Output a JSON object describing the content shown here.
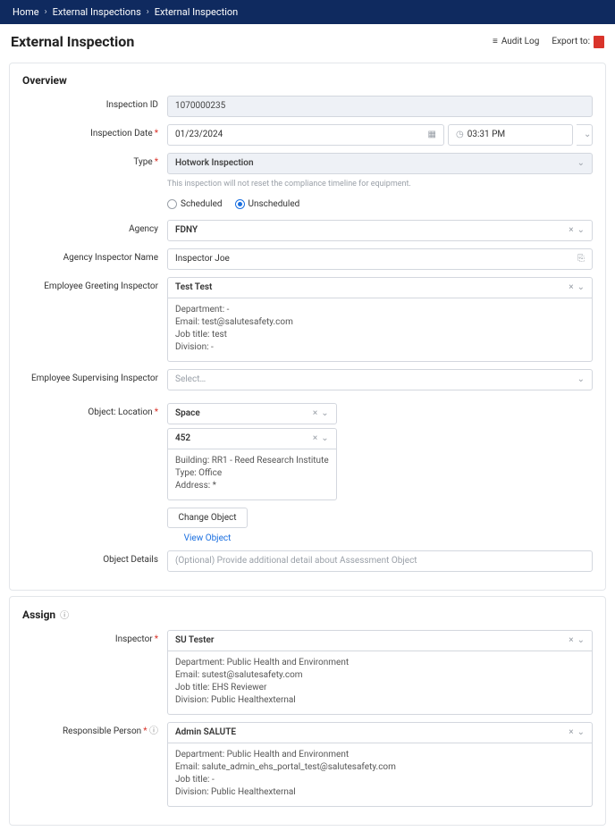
{
  "breadcrumbs": {
    "home": "Home",
    "list": "External Inspections",
    "current": "External Inspection"
  },
  "page": {
    "title": "External Inspection"
  },
  "header": {
    "audit_log": "Audit Log",
    "export_to": "Export to:"
  },
  "overview": {
    "heading": "Overview",
    "labels": {
      "inspection_id": "Inspection ID",
      "inspection_date": "Inspection Date",
      "type": "Type",
      "agency": "Agency",
      "agency_inspector_name": "Agency Inspector Name",
      "employee_greeting": "Employee Greeting Inspector",
      "employee_supervising": "Employee Supervising Inspector",
      "object_location": "Object: Location",
      "object_details": "Object Details"
    },
    "inspection_id": "1070000235",
    "inspection_date": "01/23/2024",
    "inspection_time": "03:31 PM",
    "type_value": "Hotwork Inspection",
    "type_helper": "This inspection will not reset the compliance timeline for equipment.",
    "schedule": {
      "scheduled_label": "Scheduled",
      "unscheduled_label": "Unscheduled",
      "value": "unscheduled"
    },
    "agency": "FDNY",
    "agency_inspector_name": "Inspector Joe",
    "employee_greeting": {
      "value": "Test Test",
      "department_label": "Department:",
      "department_value": "-",
      "email_label": "Email:",
      "email_value": "test@salutesafety.com",
      "job_title_label": "Job title:",
      "job_title_value": "test",
      "division_label": "Division:",
      "division_value": "-"
    },
    "employee_supervising_placeholder": "Select…",
    "object": {
      "type": "Space",
      "code": "452",
      "building_label": "Building:",
      "building_value": "RR1 - Reed Research Institute",
      "type_label": "Type:",
      "type_value": "Office",
      "address_label": "Address:",
      "address_value": "*"
    },
    "object_details_placeholder": "(Optional) Provide additional detail about Assessment Object",
    "buttons": {
      "change_object": "Change Object",
      "view_object": "View Object"
    }
  },
  "assign": {
    "heading": "Assign",
    "labels": {
      "inspector": "Inspector",
      "responsible_person": "Responsible Person"
    },
    "inspector": {
      "value": "SU Tester",
      "department_label": "Department:",
      "department_value": "Public Health and Environment",
      "email_label": "Email:",
      "email_value": "sutest@salutesafety.com",
      "job_title_label": "Job title:",
      "job_title_value": "EHS Reviewer",
      "division_label": "Division:",
      "division_value": "Public Healthexternal"
    },
    "responsible": {
      "value": "Admin SALUTE",
      "department_label": "Department:",
      "department_value": "Public Health and Environment",
      "email_label": "Email:",
      "email_value": "salute_admin_ehs_portal_test@salutesafety.com",
      "job_title_label": "Job title:",
      "job_title_value": "-",
      "division_label": "Division:",
      "division_value": "Public Healthexternal"
    }
  }
}
